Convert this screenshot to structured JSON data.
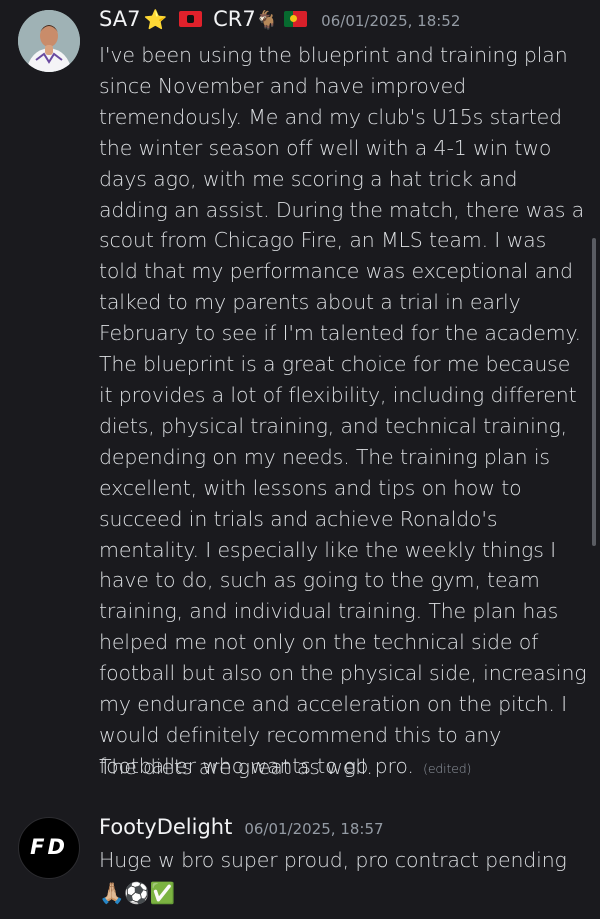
{
  "messages": [
    {
      "username": "SA7",
      "badge_icon": "star-icon",
      "badge_glyph": "⭐",
      "flag1": "albania-flag-icon",
      "alias": "CR7",
      "goat_glyph": "🐐",
      "flag2": "portugal-flag-icon",
      "timestamp": "06/01/2025, 18:52",
      "text": "I've been using the blueprint and training plan since November and have improved tremendously. Me and my club's U15s started the winter season off well with a 4-1 win two days ago, with me scoring a hat trick and adding an assist. During the match, there was a scout from Chicago Fire, an MLS team. I was told that my performance was exceptional and talked to my parents about a trial in early February to see if I'm talented for the academy. The blueprint is a great choice for me because it provides a lot of flexibility, including different diets, physical training, and technical training, depending on my needs. The training plan is excellent, with lessons and tips on how to succeed in trials and achieve Ronaldo's mentality. I especially like the weekly things I have to do, such as going to the gym, team training, and individual training. The plan has helped me not only on the technical side of football but also on the physical side, increasing my endurance and acceleration on the pitch. I would definitely recommend this to any footballer who wants to go pro.",
      "edited_label": "(edited)",
      "followup": "The diets are great as well."
    },
    {
      "username": "FootyDelight",
      "avatar_text": "FD",
      "timestamp": "06/01/2025, 18:57",
      "text": "Huge w bro super proud, pro contract pending",
      "emojis": [
        "🙏🏼",
        "⚽",
        "✅"
      ]
    }
  ],
  "colors": {
    "background": "#1a1a1e",
    "text": "#dbdee1",
    "username": "#f2f3f5",
    "muted": "#949ba4"
  }
}
